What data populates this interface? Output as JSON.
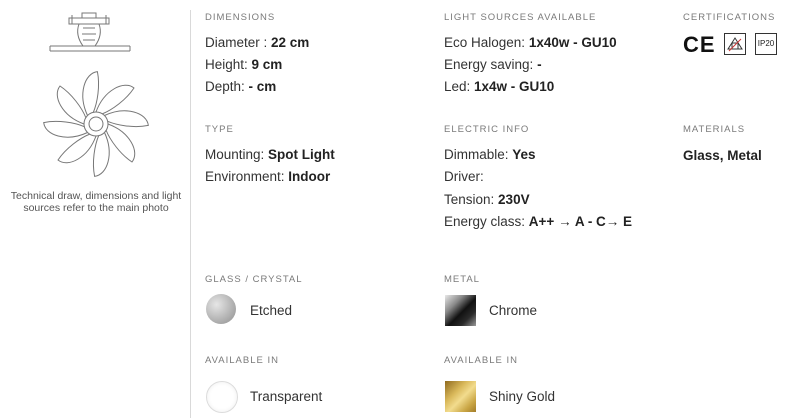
{
  "left": {
    "caption": "Technical draw, dimensions and light sources refer to the main photo"
  },
  "dimensions": {
    "heading": "DIMENSIONS",
    "rows": [
      {
        "label": "Diameter : ",
        "value": "22 cm"
      },
      {
        "label": "Height: ",
        "value": "9 cm"
      },
      {
        "label": "Depth: ",
        "value": "- cm"
      }
    ]
  },
  "light_sources": {
    "heading": "LIGHT SOURCES AVAILABLE",
    "rows": [
      {
        "label": "Eco Halogen: ",
        "value": "1x40w - GU10"
      },
      {
        "label": "Energy saving: ",
        "value": "-"
      },
      {
        "label": "Led: ",
        "value": "1x4w - GU10"
      }
    ]
  },
  "certifications": {
    "heading": "CERTIFICATIONS",
    "ce": "CE",
    "ip": "IP20"
  },
  "type": {
    "heading": "TYPE",
    "rows": [
      {
        "label": "Mounting: ",
        "value": "Spot Light"
      },
      {
        "label": "Environment: ",
        "value": "Indoor"
      }
    ]
  },
  "electric": {
    "heading": "ELECTRIC INFO",
    "rows": [
      {
        "label": "Dimmable: ",
        "value": "Yes"
      },
      {
        "label": "Driver: ",
        "value": ""
      },
      {
        "label": "Tension: ",
        "value": "230V"
      },
      {
        "label": "Energy class: ",
        "value": "A++ → A - C→ E"
      }
    ]
  },
  "materials": {
    "heading": "MATERIALS",
    "value": "Glass, Metal"
  },
  "glass": {
    "heading": "GLASS / CRYSTAL",
    "option": "Etched",
    "color": "#bdbdbd"
  },
  "metal": {
    "heading": "METAL",
    "option": "Chrome",
    "color": "#3a3a3a"
  },
  "available_glass": {
    "heading": "AVAILABLE IN",
    "option": "Transparent",
    "color": "#ffffff"
  },
  "available_metal": {
    "heading": "AVAILABLE IN",
    "option": "Shiny Gold",
    "color": "#c9a544"
  }
}
